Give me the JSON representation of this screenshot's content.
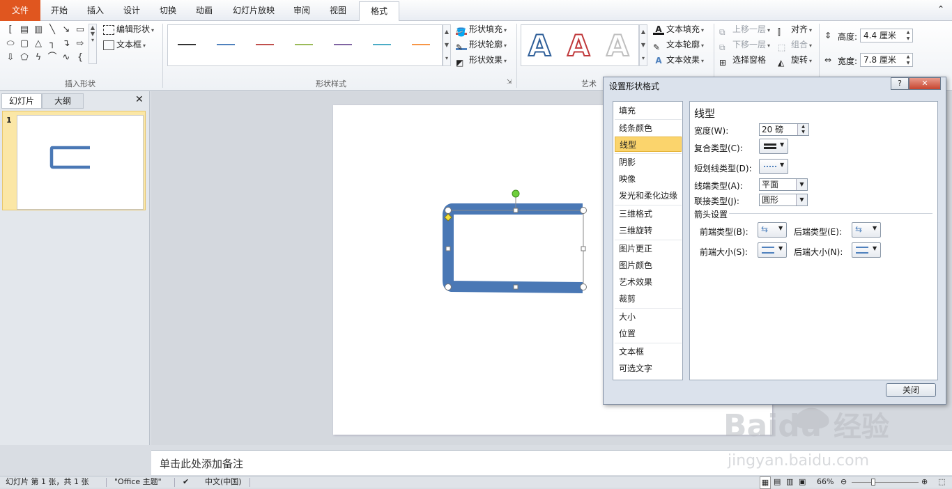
{
  "tabs": {
    "file": "文件",
    "home": "开始",
    "insert": "插入",
    "design": "设计",
    "transitions": "切换",
    "animations": "动画",
    "slideshow": "幻灯片放映",
    "review": "审阅",
    "view": "视图",
    "format": "格式"
  },
  "ribbon": {
    "insert_shapes_group": "插入形状",
    "edit_shape": "编辑形状",
    "text_box": "文本框",
    "shape_styles_group": "形状样式",
    "shape_fill": "形状填充",
    "shape_outline": "形状轮廓",
    "shape_effects": "形状效果",
    "wordart_group": "艺术",
    "text_fill": "文本填充",
    "text_outline": "文本轮廓",
    "text_effects": "文本效果",
    "bring_forward": "上移一层",
    "send_backward": "下移一层",
    "selection_pane": "选择窗格",
    "align": "对齐",
    "group": "组合",
    "rotate": "旋转",
    "height_label": "高度:",
    "height_value": "4.4 厘米",
    "width_label": "宽度:",
    "width_value": "7.8 厘米",
    "line_colors": [
      "#333333",
      "#4f81bd",
      "#c0504d",
      "#9bbb59",
      "#8064a2",
      "#4bacc6",
      "#f79646"
    ],
    "wordart_colors": [
      "#2f5f99",
      "#c0393b",
      "#bfbfbf"
    ]
  },
  "left_panel": {
    "tab_slides": "幻灯片",
    "tab_outline": "大纲",
    "slide_number": "1"
  },
  "notes_placeholder": "单击此处添加备注",
  "status": {
    "slide_info": "幻灯片 第 1 张，共 1 张",
    "theme": "\"Office 主题\"",
    "language": "中文(中国)",
    "zoom": "66%"
  },
  "dialog": {
    "title": "设置形状格式",
    "help": "?",
    "nav": [
      "填充",
      "线条颜色",
      "线型",
      "阴影",
      "映像",
      "发光和柔化边缘",
      "三维格式",
      "三维旋转",
      "图片更正",
      "图片颜色",
      "艺术效果",
      "裁剪",
      "大小",
      "位置",
      "文本框",
      "可选文字"
    ],
    "section_title": "线型",
    "width_label": "宽度(W):",
    "width_value": "20 磅",
    "compound_label": "复合类型(C):",
    "dash_label": "短划线类型(D):",
    "cap_label": "线端类型(A):",
    "cap_value": "平面",
    "join_label": "联接类型(J):",
    "join_value": "圆形",
    "arrow_section": "箭头设置",
    "begin_type": "前端类型(B):",
    "end_type": "后端类型(E):",
    "begin_size": "前端大小(S):",
    "end_size": "后端大小(N):",
    "close": "关闭"
  },
  "shape_color": "#4a78b5",
  "watermark": {
    "brand": "Baidu",
    "cn": "经验",
    "url": "jingyan.baidu.com"
  }
}
